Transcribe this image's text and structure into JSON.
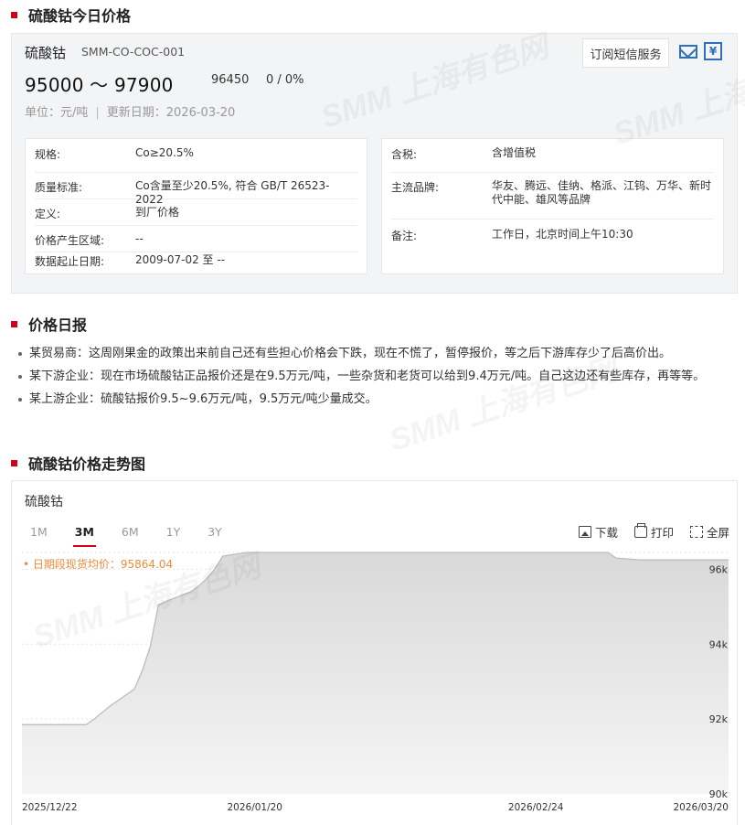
{
  "sections": {
    "today_title": "硫酸钴今日价格",
    "daily_title": "价格日报",
    "trend_title": "硫酸钴价格走势图"
  },
  "product": {
    "name": "硫酸钴",
    "code": "SMM-CO-COC-001",
    "price_range": "95000 ～ 97900",
    "avg_price": "96450",
    "change": "0 / 0%",
    "unit": "单位：元/吨",
    "update_date": "更新日期：2026-03-20",
    "subscribe_label": "订阅短信服务",
    "calendar_glyph": "¥",
    "watermark_text": "SMM 上海有色网"
  },
  "icons": {
    "mail": "mail-icon",
    "calendar": "calendar-yuan-icon",
    "download": "image-download-icon",
    "print": "printer-icon",
    "fullscreen": "fullscreen-icon"
  },
  "specs_left": [
    {
      "label": "规格:",
      "value": "Co≥20.5%"
    },
    {
      "label": "质量标准:",
      "value": "Co含量至少20.5%, 符合 GB/T 26523-2022"
    },
    {
      "label": "定义:",
      "value": "到厂价格"
    },
    {
      "label": "价格产生区域:",
      "value": "--"
    },
    {
      "label": "数据起止日期:",
      "value": "2009-07-02 至 --"
    }
  ],
  "specs_right": [
    {
      "label": "含税:",
      "value": "含增值税"
    },
    {
      "label": "主流品牌:",
      "value": "华友、腾远、佳纳、格派、江钨、万华、新时代中能、雄风等品牌"
    },
    {
      "label": "备注:",
      "value": "工作日，北京时间上午10:30"
    }
  ],
  "daily_report": [
    "某贸易商：这周刚果金的政策出来前自己还有些担心价格会下跌，现在不慌了，暂停报价，等之后下游库存少了后高价出。",
    "某下游企业：现在市场硫酸钴正品报价还是在9.5万元/吨，一些杂货和老货可以给到9.4万元/吨。自己这边还有些库存，再等等。",
    "某上游企业：硫酸钴报价9.5~9.6万元/吨，9.5万元/吨少量成交。"
  ],
  "chart_panel": {
    "name": "硫酸钴",
    "tabs": [
      "1M",
      "3M",
      "6M",
      "1Y",
      "3Y"
    ],
    "active_tab": "3M",
    "tools": {
      "download": "下载",
      "print": "打印",
      "fullscreen": "全屏"
    },
    "avg_note": "• 日期段现货均价：95864.04"
  },
  "colors": {
    "accent_red": "#d0021b",
    "icon_blue": "#2d6fb8",
    "avg_orange": "#f08a3c",
    "area_fill": "#e6e6e6",
    "line": "#bdbdbd"
  },
  "chart_data": {
    "type": "area",
    "title": "",
    "xlabel": "",
    "ylabel": "",
    "x_ticks": [
      "2025/12/22",
      "2026/01/20",
      "2026/02/24",
      "2026/03/20"
    ],
    "y_ticks": [
      "90k",
      "92k",
      "94k",
      "96k"
    ],
    "ylim": [
      90000,
      96450
    ],
    "grid": true,
    "series": [
      {
        "x": [
          "2025-12-22",
          "2025-12-23",
          "2025-12-24",
          "2025-12-25",
          "2025-12-26",
          "2025-12-29",
          "2025-12-30",
          "2025-12-31",
          "2026-01-02",
          "2026-01-05",
          "2026-01-06",
          "2026-01-07",
          "2026-01-08",
          "2026-01-09",
          "2026-01-12",
          "2026-01-13",
          "2026-01-14",
          "2026-01-15",
          "2026-01-16",
          "2026-01-19",
          "2026-01-20",
          "2026-01-21",
          "2026-02-05",
          "2026-02-10",
          "2026-02-20",
          "2026-03-04",
          "2026-03-05",
          "2026-03-06",
          "2026-03-09",
          "2026-03-10",
          "2026-03-12",
          "2026-03-16",
          "2026-03-20"
        ],
        "values": [
          91850,
          91850,
          91850,
          91850,
          91850,
          91850,
          91850,
          92000,
          92350,
          92800,
          93300,
          93950,
          95050,
          95150,
          95400,
          95550,
          95750,
          96000,
          96350,
          96450,
          96450,
          96450,
          96450,
          96450,
          96450,
          96450,
          96450,
          96300,
          96250,
          96250,
          96250,
          96250,
          96250
        ]
      }
    ]
  }
}
